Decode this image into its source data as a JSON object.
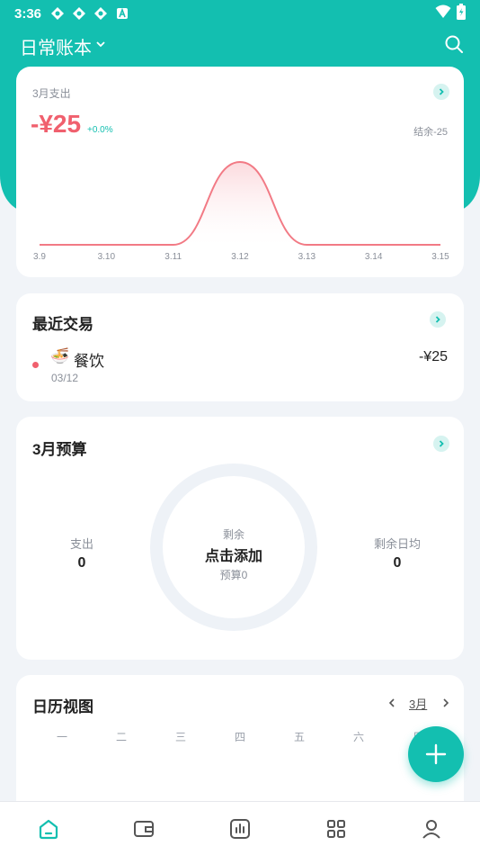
{
  "status": {
    "time": "3:36"
  },
  "header": {
    "title": "日常账本"
  },
  "spending": {
    "label": "3月支出",
    "amount": "-¥25",
    "change": "+0.0%",
    "balance": "结余-25"
  },
  "chart_data": {
    "type": "area",
    "categories": [
      "3.9",
      "3.10",
      "3.11",
      "3.12",
      "3.13",
      "3.14",
      "3.15"
    ],
    "values": [
      0,
      0,
      0,
      25,
      0,
      0,
      0
    ],
    "title": "",
    "xlabel": "",
    "ylabel": "",
    "grid": false,
    "colors": {
      "line": "#f27a85",
      "fill_top": "#fbd6da"
    }
  },
  "recent": {
    "title": "最近交易",
    "items": [
      {
        "emoji": "🍜",
        "category": "餐饮",
        "date": "03/12",
        "amount": "-¥25"
      }
    ]
  },
  "budget": {
    "title": "3月预算",
    "expense_label": "支出",
    "expense_value": "0",
    "remaining_label": "剩余",
    "center_action": "点击添加",
    "budget_label": "预算0",
    "daily_label": "剩余日均",
    "daily_value": "0"
  },
  "calendar": {
    "title": "日历视图",
    "month": "3月",
    "weekdays": [
      "一",
      "二",
      "三",
      "四",
      "五",
      "六",
      "日"
    ]
  },
  "colors": {
    "accent": "#13bfb0",
    "negative": "#f0606e"
  }
}
